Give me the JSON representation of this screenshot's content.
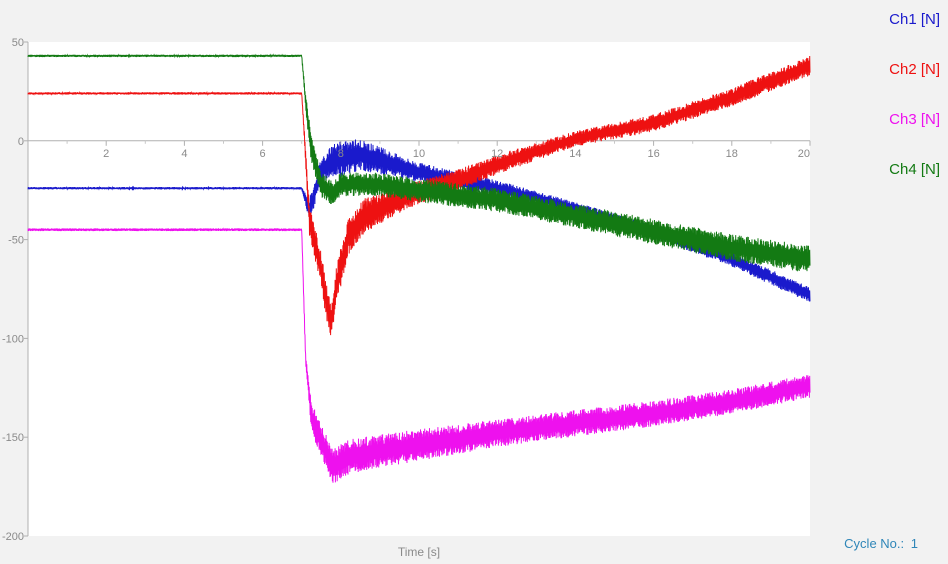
{
  "chart_data": {
    "type": "line",
    "title": "",
    "xlabel": "Time [s]",
    "ylabel": "",
    "xlim": [
      0,
      20
    ],
    "ylim": [
      -200,
      50
    ],
    "x_ticks": [
      "2",
      "4",
      "6",
      "8",
      "10",
      "12",
      "14",
      "16",
      "18",
      "20"
    ],
    "y_ticks": [
      "50",
      "0",
      "-50",
      "-100",
      "-150",
      "-200"
    ],
    "legend_position": "right",
    "grid": false,
    "series": [
      {
        "name": "Ch1 [N]",
        "color": "#1a1acc",
        "points": [
          [
            0,
            -24
          ],
          [
            7,
            -24
          ],
          [
            7.2,
            -35
          ],
          [
            7.5,
            -15
          ],
          [
            7.8,
            -10
          ],
          [
            8.5,
            -7
          ],
          [
            10,
            -16
          ],
          [
            12,
            -24
          ],
          [
            14,
            -34
          ],
          [
            16,
            -46
          ],
          [
            18,
            -60
          ],
          [
            20,
            -78
          ]
        ],
        "noise": [
          [
            0,
            0.6
          ],
          [
            7,
            0.6
          ],
          [
            7.2,
            6
          ],
          [
            8,
            9
          ],
          [
            10,
            5
          ],
          [
            14,
            3
          ],
          [
            20,
            4
          ]
        ]
      },
      {
        "name": "Ch2 [N]",
        "color": "#ee1111",
        "points": [
          [
            0,
            24
          ],
          [
            7,
            24
          ],
          [
            7.2,
            -40
          ],
          [
            7.5,
            -65
          ],
          [
            7.6,
            -78
          ],
          [
            7.75,
            -92
          ],
          [
            7.9,
            -72
          ],
          [
            8.2,
            -48
          ],
          [
            8.6,
            -38
          ],
          [
            9.5,
            -30
          ],
          [
            10,
            -26
          ],
          [
            11,
            -20
          ],
          [
            12,
            -12
          ],
          [
            14,
            1
          ],
          [
            16,
            9
          ],
          [
            18,
            22
          ],
          [
            20,
            38
          ]
        ],
        "noise": [
          [
            0,
            0.6
          ],
          [
            7,
            0.6
          ],
          [
            7.2,
            8
          ],
          [
            8,
            10
          ],
          [
            10,
            6
          ],
          [
            14,
            4
          ],
          [
            20,
            5
          ]
        ]
      },
      {
        "name": "Ch3 [N]",
        "color": "#ee11ee",
        "points": [
          [
            0,
            -45
          ],
          [
            7,
            -45
          ],
          [
            7.1,
            -110
          ],
          [
            7.25,
            -140
          ],
          [
            7.5,
            -152
          ],
          [
            7.8,
            -165
          ],
          [
            8.2,
            -160
          ],
          [
            9,
            -157
          ],
          [
            10,
            -154
          ],
          [
            12,
            -148
          ],
          [
            14,
            -143
          ],
          [
            16,
            -138
          ],
          [
            18,
            -132
          ],
          [
            20,
            -124
          ]
        ],
        "noise": [
          [
            0,
            0.7
          ],
          [
            7,
            0.7
          ],
          [
            7.3,
            8
          ],
          [
            8,
            9
          ],
          [
            12,
            7
          ],
          [
            20,
            6
          ]
        ]
      },
      {
        "name": "Ch4 [N]",
        "color": "#137a13",
        "points": [
          [
            0,
            43
          ],
          [
            7,
            43
          ],
          [
            7.1,
            20
          ],
          [
            7.25,
            -5
          ],
          [
            7.5,
            -22
          ],
          [
            7.8,
            -27
          ],
          [
            8,
            -22
          ],
          [
            9,
            -22
          ],
          [
            10,
            -25
          ],
          [
            12,
            -30
          ],
          [
            14,
            -38
          ],
          [
            16,
            -46
          ],
          [
            18,
            -54
          ],
          [
            20,
            -60
          ]
        ],
        "noise": [
          [
            0,
            0.6
          ],
          [
            7,
            0.6
          ],
          [
            7.2,
            7
          ],
          [
            8,
            6
          ],
          [
            12,
            6
          ],
          [
            20,
            7
          ]
        ]
      }
    ]
  },
  "footer": {
    "cycle_label": "Cycle No.:",
    "cycle_value": "1"
  }
}
